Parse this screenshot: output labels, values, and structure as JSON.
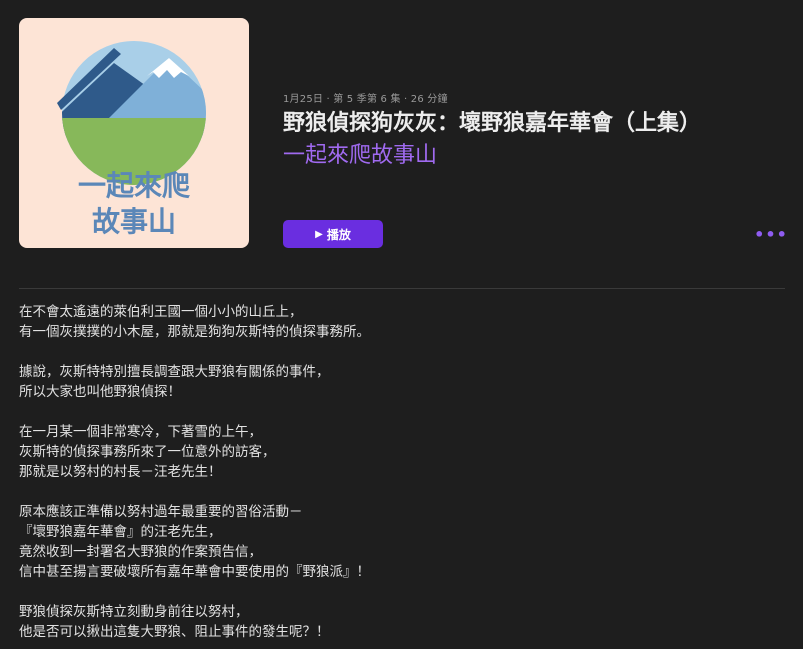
{
  "artwork": {
    "text_line1": "一起來爬",
    "text_line2": "故事山",
    "colors": {
      "background": "#fde4d6",
      "sky": "#a9cfe8",
      "mountain_dark": "#2f5a8a",
      "mountain_light": "#7fb0d8",
      "snow": "#ffffff",
      "grass": "#87b85a",
      "text": "#5b87b8"
    }
  },
  "episode": {
    "meta": "1月25日 · 第 5 季第 6 集 · 26 分鐘",
    "title": "野狼偵探狗灰灰：壞野狼嘉年華會（上集）",
    "show_name": "一起來爬故事山"
  },
  "actions": {
    "play_label": "播放",
    "play_icon": "play-icon",
    "more_label": "•••",
    "more_icon": "more-icon"
  },
  "description": {
    "paragraphs": [
      [
        "在不會太遙遠的萊伯利王國一個小小的山丘上，",
        "有一個灰撲撲的小木屋，那就是狗狗灰斯特的偵探事務所。"
      ],
      [
        "據說，灰斯特特別擅長調查跟大野狼有關係的事件，",
        "所以大家也叫他野狼偵探！"
      ],
      [
        "在一月某一個非常寒冷，下著雪的上午，",
        "灰斯特的偵探事務所來了一位意外的訪客，",
        "那就是以努村的村長－汪老先生！"
      ],
      [
        "原本應該正準備以努村過年最重要的習俗活動－",
        "『壞野狼嘉年華會』的汪老先生，",
        "竟然收到一封署名大野狼的作案預告信，",
        "信中甚至揚言要破壞所有嘉年華會中要使用的『野狼派』！"
      ],
      [
        "野狼偵探灰斯特立刻動身前往以努村，",
        "他是否可以揪出這隻大野狼、阻止事件的發生呢？！"
      ]
    ]
  },
  "colors": {
    "background": "#1e1e1e",
    "accent": "#6a2ee0",
    "link": "#a06af0"
  }
}
